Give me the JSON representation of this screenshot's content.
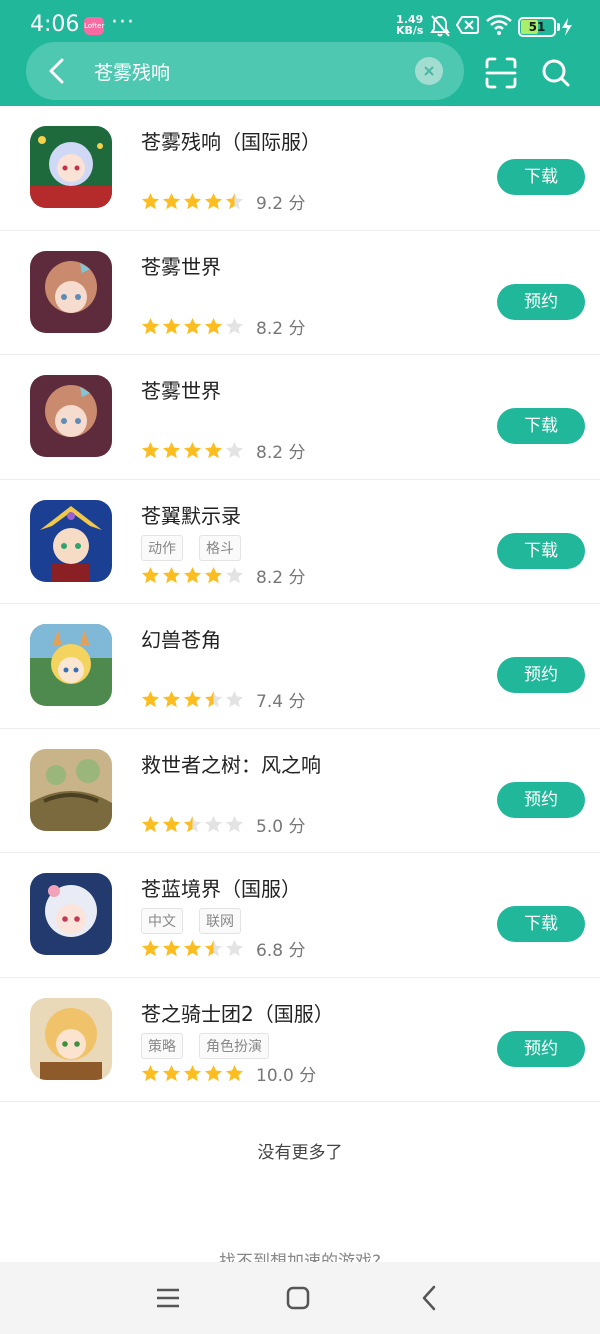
{
  "status_bar": {
    "time": "4:06",
    "app_badge": "Lofter",
    "more_dots": "···",
    "net_speed_value": "1.49",
    "net_speed_unit": "KB/s",
    "battery": "51",
    "icons": [
      "mute-bell-icon",
      "sim-off-icon",
      "wifi-icon",
      "battery-icon",
      "charging-icon"
    ]
  },
  "search": {
    "query": "苍雾残响",
    "icons": [
      "back-icon",
      "clear-icon",
      "scan-icon",
      "search-icon"
    ]
  },
  "games": [
    {
      "name": "苍雾残响（国际服）",
      "tags": [],
      "stars": 4.5,
      "score": "9.2 分",
      "action": "下载"
    },
    {
      "name": "苍雾世界",
      "tags": [],
      "stars": 4,
      "score": "8.2 分",
      "action": "预约"
    },
    {
      "name": "苍雾世界",
      "tags": [],
      "stars": 4,
      "score": "8.2 分",
      "action": "下载"
    },
    {
      "name": "苍翼默示录",
      "tags": [
        "动作",
        "格斗"
      ],
      "stars": 4,
      "score": "8.2 分",
      "action": "下载"
    },
    {
      "name": "幻兽苍角",
      "tags": [],
      "stars": 3.5,
      "score": "7.4 分",
      "action": "预约"
    },
    {
      "name": "救世者之树：风之响",
      "tags": [],
      "stars": 2.5,
      "score": "5.0 分",
      "action": "预约"
    },
    {
      "name": "苍蓝境界（国服）",
      "tags": [
        "中文",
        "联网"
      ],
      "stars": 3.5,
      "score": "6.8 分",
      "action": "下载"
    },
    {
      "name": "苍之骑士团2（国服）",
      "tags": [
        "策略",
        "角色扮演"
      ],
      "stars": 5,
      "score": "10.0 分",
      "action": "预约"
    }
  ],
  "list_end": "没有更多了",
  "footer_hint": "找不到想加速的游戏?",
  "nav": {
    "icons": [
      "menu-icon",
      "home-icon",
      "back-nav-icon"
    ]
  },
  "colors": {
    "brand": "#20b79a",
    "star": "#fbbd1f",
    "star_empty": "#e3e3e3"
  }
}
